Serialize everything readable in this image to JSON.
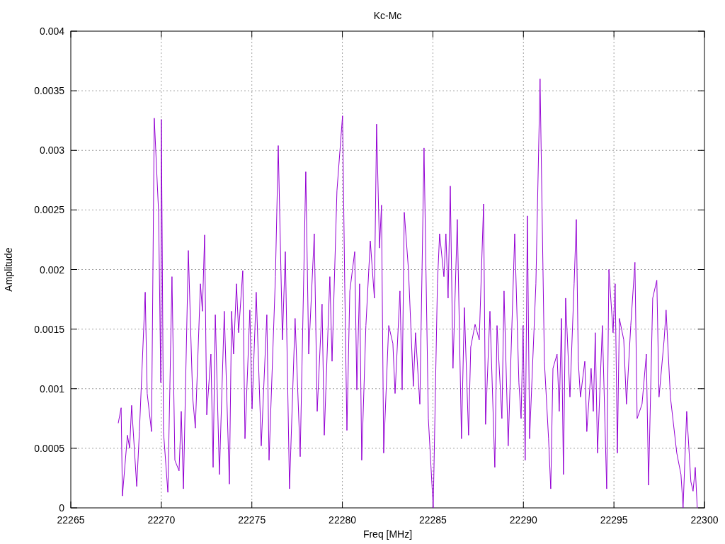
{
  "chart": {
    "chart_data": {
      "type": "line",
      "title": "Kc-Mc",
      "xlabel": "Freq [MHz]",
      "ylabel": "Amplitude",
      "grid": true,
      "xlim": [
        22265,
        22300
      ],
      "ylim": [
        0,
        0.004
      ],
      "xticks": [
        22265,
        22270,
        22275,
        22280,
        22285,
        22290,
        22295,
        22300
      ],
      "yticks": [
        {
          "value": 0,
          "label": "0"
        },
        {
          "value": 0.0005,
          "label": "0.0005"
        },
        {
          "value": 0.001,
          "label": "0.001"
        },
        {
          "value": 0.0015,
          "label": "0.0015"
        },
        {
          "value": 0.002,
          "label": "0.002"
        },
        {
          "value": 0.0025,
          "label": "0.0025"
        },
        {
          "value": 0.003,
          "label": "0.003"
        },
        {
          "value": 0.0035,
          "label": "0.0035"
        },
        {
          "value": 0.004,
          "label": "0.004"
        }
      ],
      "x": [
        22267.62,
        22267.78,
        22267.85,
        22268.13,
        22268.25,
        22268.36,
        22268.64,
        22268.79,
        22269.11,
        22269.22,
        22269.46,
        22269.61,
        22269.85,
        22269.97,
        22270.0,
        22270.12,
        22270.36,
        22270.59,
        22270.75,
        22270.98,
        22271.1,
        22271.22,
        22271.49,
        22271.73,
        22271.88,
        22272.16,
        22272.27,
        22272.39,
        22272.51,
        22272.74,
        22272.86,
        22272.98,
        22273.21,
        22273.48,
        22273.76,
        22273.88,
        22273.99,
        22274.15,
        22274.27,
        22274.5,
        22274.62,
        22274.89,
        22275.01,
        22275.24,
        22275.52,
        22275.83,
        22275.95,
        22276.3,
        22276.46,
        22276.69,
        22276.85,
        22277.08,
        22277.39,
        22277.67,
        22277.98,
        22278.14,
        22278.45,
        22278.61,
        22278.88,
        22279.0,
        22279.31,
        22279.43,
        22279.7,
        22280.01,
        22280.13,
        22280.25,
        22280.41,
        22280.68,
        22280.8,
        22280.95,
        22281.07,
        22281.3,
        22281.54,
        22281.77,
        22281.89,
        22282.05,
        22282.16,
        22282.28,
        22282.56,
        22282.79,
        22282.91,
        22283.18,
        22283.3,
        22283.42,
        22283.65,
        22283.92,
        22284.04,
        22284.28,
        22284.51,
        22284.75,
        22285.02,
        22285.25,
        22285.37,
        22285.61,
        22285.72,
        22285.84,
        22285.96,
        22286.11,
        22286.35,
        22286.58,
        22286.74,
        22286.97,
        22287.09,
        22287.33,
        22287.56,
        22287.8,
        22287.91,
        22288.15,
        22288.42,
        22288.54,
        22288.81,
        22288.93,
        22289.16,
        22289.52,
        22289.75,
        22289.87,
        22289.98,
        22290.1,
        22290.22,
        22290.34,
        22290.69,
        22290.92,
        22291.16,
        22291.39,
        22291.51,
        22291.63,
        22291.86,
        22291.98,
        22292.1,
        22292.21,
        22292.33,
        22292.57,
        22292.8,
        22292.92,
        22293.03,
        22293.15,
        22293.39,
        22293.5,
        22293.74,
        22293.86,
        22293.97,
        22294.09,
        22294.36,
        22294.6,
        22294.72,
        22294.95,
        22295.07,
        22295.19,
        22295.3,
        22295.54,
        22295.69,
        22295.93,
        22296.16,
        22296.28,
        22296.55,
        22296.79,
        22296.91,
        22297.14,
        22297.37,
        22297.49,
        22297.77,
        22297.88,
        22298.12,
        22298.47,
        22298.7,
        22298.82,
        22299.02,
        22299.25,
        22299.37,
        22299.49,
        22299.6
      ],
      "series": [
        {
          "color": "#9400d3",
          "values": [
            0.00071,
            0.00084,
            0.0001,
            0.00061,
            0.0005,
            0.00086,
            0.00018,
            0.00064,
            0.00181,
            0.00096,
            0.00064,
            0.00327,
            0.00248,
            0.00105,
            0.00326,
            0.00064,
            0.00013,
            0.00194,
            0.0004,
            0.00031,
            0.00081,
            0.00016,
            0.00216,
            0.00093,
            0.00067,
            0.00188,
            0.00165,
            0.00229,
            0.00078,
            0.00129,
            0.00034,
            0.00162,
            0.00028,
            0.00165,
            0.0002,
            0.00165,
            0.00129,
            0.00188,
            0.00147,
            0.00199,
            0.00058,
            0.00166,
            0.00083,
            0.00181,
            0.00052,
            0.00162,
            0.0004,
            0.00194,
            0.00304,
            0.00141,
            0.00215,
            0.00016,
            0.00159,
            0.00043,
            0.00282,
            0.00129,
            0.0023,
            0.00081,
            0.00171,
            0.00061,
            0.00194,
            0.00123,
            0.00266,
            0.00329,
            0.00188,
            0.00065,
            0.00182,
            0.00215,
            0.00099,
            0.00188,
            0.0004,
            0.00153,
            0.00224,
            0.00176,
            0.00322,
            0.00218,
            0.00254,
            0.00046,
            0.00153,
            0.00138,
            0.00096,
            0.00182,
            0.00099,
            0.00248,
            0.002,
            0.00102,
            0.00147,
            0.00087,
            0.00302,
            0.00075,
            0,
            0.00188,
            0.0023,
            0.00194,
            0.0023,
            0.00176,
            0.0027,
            0.00117,
            0.00242,
            0.00058,
            0.00168,
            0.00061,
            0.00135,
            0.00154,
            0.00141,
            0.00255,
            0.0007,
            0.00165,
            0.00034,
            0.00153,
            0.00075,
            0.00182,
            0.00052,
            0.0023,
            0.00105,
            0.00075,
            0.00153,
            0.0004,
            0.00245,
            0.00058,
            0.00188,
            0.0036,
            0.00123,
            0.00058,
            0.00016,
            0.00117,
            0.00129,
            0.00081,
            0.00159,
            0.00028,
            0.00176,
            0.00093,
            0.00188,
            0.00242,
            0.00123,
            0.00093,
            0.00123,
            0.00064,
            0.00117,
            0.00081,
            0.00147,
            0.00046,
            0.00153,
            0.00016,
            0.002,
            0.00147,
            0.00188,
            0.00046,
            0.00159,
            0.00141,
            0.00087,
            0.00153,
            0.00206,
            0.00075,
            0.00087,
            0.00129,
            0.00019,
            0.00176,
            0.00191,
            0.00093,
            0.00141,
            0.00166,
            0.00093,
            0.00046,
            0.00028,
            0,
            0.00081,
            0.00022,
            0.00014,
            0.00034,
            0
          ]
        }
      ]
    }
  }
}
